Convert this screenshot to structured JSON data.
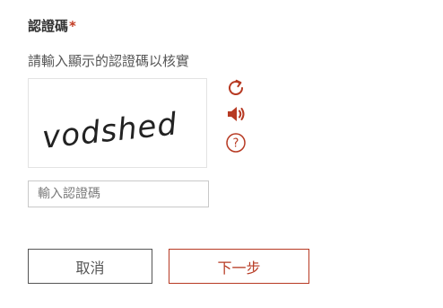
{
  "form": {
    "label": "認證碼",
    "required_mark": "*",
    "instruction": "請輸入顯示的認證碼以核實",
    "captcha_text": "vodshed",
    "input_placeholder": "輸入認證碼",
    "input_value": ""
  },
  "tools": {
    "refresh_icon": "refresh-icon",
    "audio_icon": "speaker-icon",
    "help_icon": "question-mark-icon",
    "help_glyph": "?"
  },
  "buttons": {
    "cancel_label": "取消",
    "next_label": "下一步"
  },
  "colors": {
    "accent": "#b73a23",
    "text": "#333333",
    "border": "#c9c9c9"
  }
}
